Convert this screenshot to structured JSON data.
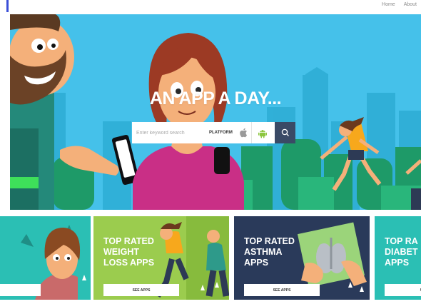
{
  "topnav": {
    "home": "Home",
    "about": "About"
  },
  "hero": {
    "title": "AN APP A DAY...",
    "search": {
      "placeholder": "Enter keyword search",
      "platform_label": "PLATFORM"
    }
  },
  "cards": [
    {
      "title": "",
      "button": ""
    },
    {
      "title": "TOP RATED\nWEIGHT\nLOSS APPS",
      "button": "SEE APPS"
    },
    {
      "title": "TOP RATED\nASTHMA\nAPPS",
      "button": "SEE APPS"
    },
    {
      "title": "TOP RA\nDIABET\nAPPS",
      "button": "SE"
    }
  ],
  "card_colors": [
    "#2bbfb4",
    "#9bcc4e",
    "#2a3a5a",
    "#2bbfb4"
  ],
  "icons": [
    "apple-icon",
    "android-icon",
    "search-icon"
  ]
}
